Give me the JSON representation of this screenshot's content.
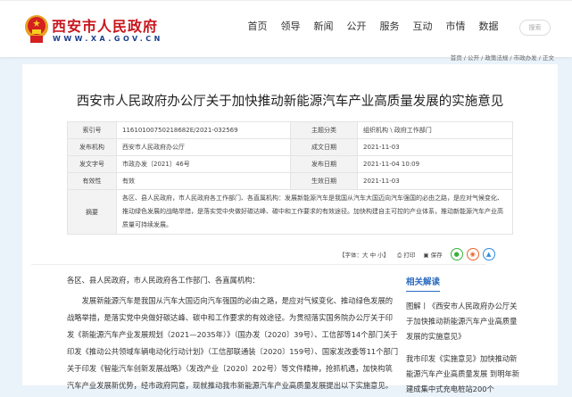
{
  "header": {
    "site_name": "西安市人民政府",
    "site_url": "WWW.XA.GOV.CN",
    "nav": [
      "首页",
      "领导",
      "新闻",
      "公开",
      "服务",
      "互动",
      "市情",
      "数据"
    ],
    "search_label": "搜索"
  },
  "breadcrumb": "首页 / 公开 / 政策法规 / 市政办发 / 正文",
  "title": "西安市人民政府办公厅关于加快推动新能源汽车产业高质量发展的实施意见",
  "meta": [
    {
      "l1": "索引号",
      "v1": "11610100750218682E/2021-032569",
      "l2": "主题分类",
      "v2": "组织机构 \\ 政府工作部门"
    },
    {
      "l1": "发布机构",
      "v1": "西安市人民政府办公厅",
      "l2": "成文日期",
      "v2": "2021-11-03"
    },
    {
      "l1": "发文字号",
      "v1": "市政办发〔2021〕46号",
      "l2": "发布日期",
      "v2": "2021-11-04 10:09"
    },
    {
      "l1": "有效性",
      "v1": "有效",
      "l2": "生效日期",
      "v2": "2021-11-03"
    }
  ],
  "summary": {
    "label": "摘要",
    "text": "各区、县人民政府，市人民政府各工作部门、各直属机构：发展新能源汽车是我国从汽车大国迈向汽车强国的必由之路，是应对气候变化、推动绿色发展的战略举措，是落实党中央做好碳达峰、碳中和工作要求的有效途径。加快构建自主可控的产业体系，推动新能源汽车产业高质量可持续发展。"
  },
  "tools": {
    "font": "【字体：大 中 小】",
    "print": "打印",
    "save": "保存"
  },
  "body": {
    "salutation": "各区、县人民政府，市人民政府各工作部门、各直属机构：",
    "para1": "发展新能源汽车是我国从汽车大国迈向汽车强国的必由之路，是应对气候变化、推动绿色发展的战略举措，是落实党中央做好碳达峰、碳中和工作要求的有效途径。为贯彻落实国务院办公厅关于印发《新能源汽车产业发展规划（2021—2035年）》（国办发〔2020〕39号）、工信部等14个部门关于印发《推动公共领域车辆电动化行动计划》（工信部联通装〔2020〕159号）、国家发改委等11个部门关于印发《智能汽车创新发展战略》（发改产业〔2020〕202号）等文件精神，抢抓机遇，加快构筑汽车产业发展新优势，经市政府同意，现就推动我市新能源汽车产业高质量发展提出以下实施意见。"
  },
  "sidebar": {
    "heading": "相关解读",
    "items": [
      "图解丨《西安市人民政府办公厅关于加快推动新能源汽车产业高质量发展的实施意见》",
      "我市印发《实施意见》加快推动新能源汽车产业高质量发展 到明年新建成集中式充电桩站200个"
    ]
  }
}
